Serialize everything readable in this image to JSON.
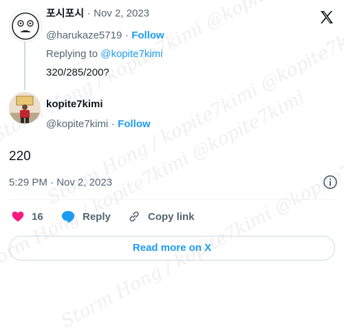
{
  "parent_tweet": {
    "display_name": "포시포시",
    "date": "Nov 2, 2023",
    "handle": "@harukaze5719",
    "follow_label": "Follow",
    "replying_prefix": "Replying to",
    "replying_to": "@kopite7kimi",
    "text": "320/285/200?"
  },
  "reply_tweet": {
    "display_name": "kopite7kimi",
    "handle": "@kopite7kimi",
    "follow_label": "Follow",
    "text": "220",
    "timestamp": "5:29 PM · Nov 2, 2023"
  },
  "actions": {
    "like_count": "16",
    "reply_label": "Reply",
    "copy_link_label": "Copy link"
  },
  "read_more_label": "Read more on X",
  "watermark_text": "Storm Hong / kopite7kimi @kopite7kimi",
  "colors": {
    "accent": "#1d9bf0",
    "like": "#f91880",
    "muted": "#536471",
    "text": "#0f1419"
  }
}
